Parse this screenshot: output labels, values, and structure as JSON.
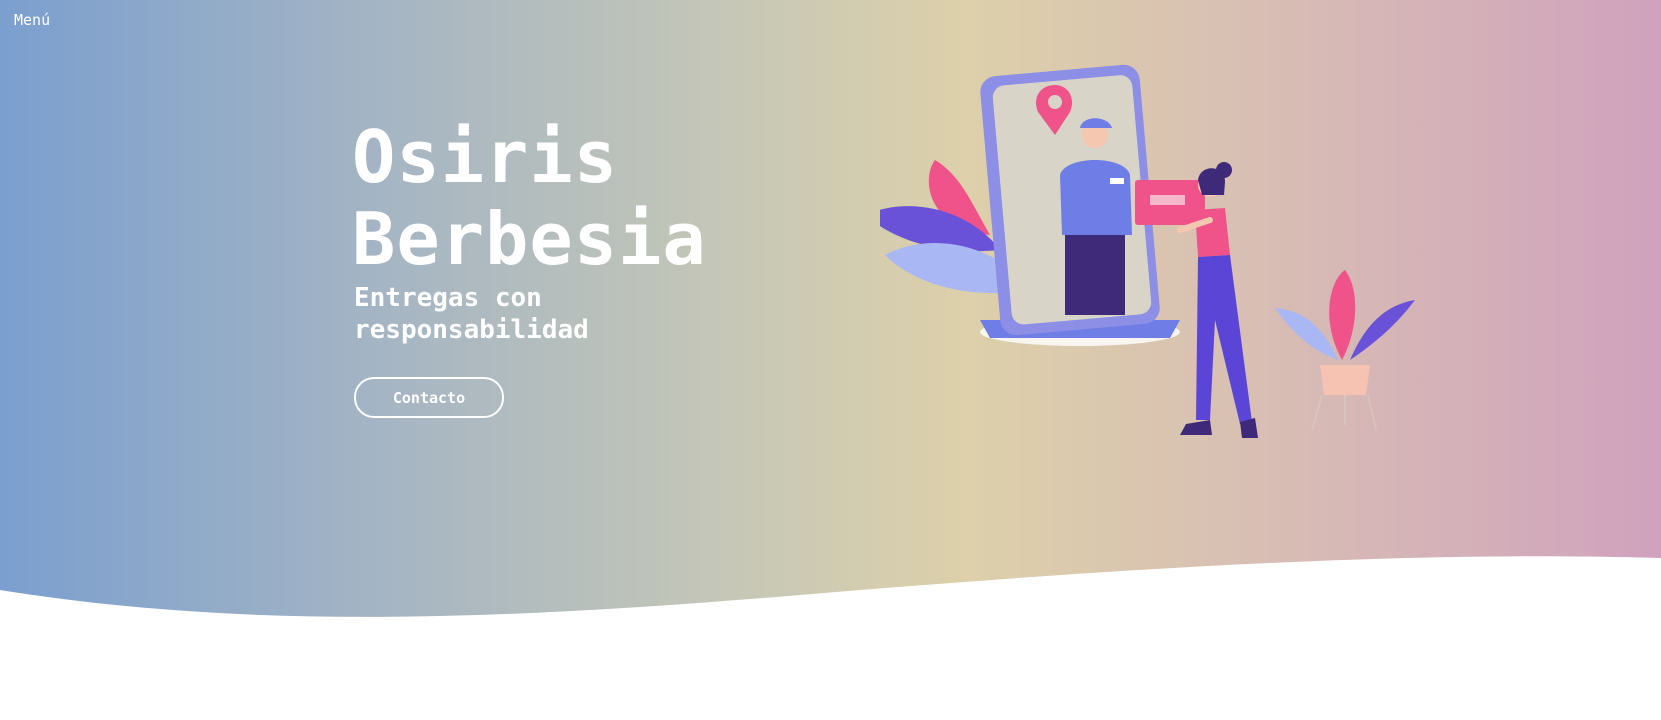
{
  "nav": {
    "menu_label": "Menú"
  },
  "hero": {
    "title_line1": "Osiris",
    "title_line2": "Berbesia",
    "subtitle": "Entregas con responsabilidad",
    "cta_label": "Contacto"
  },
  "illustration": {
    "icon": "delivery-illustration"
  },
  "colors": {
    "gradient_start": "#7b9fcf",
    "gradient_mid": "#ddd0aa",
    "gradient_end": "#d0a2bd",
    "accent_pink": "#f0528a",
    "accent_purple": "#5b45d6",
    "accent_blue": "#6f7de6"
  }
}
